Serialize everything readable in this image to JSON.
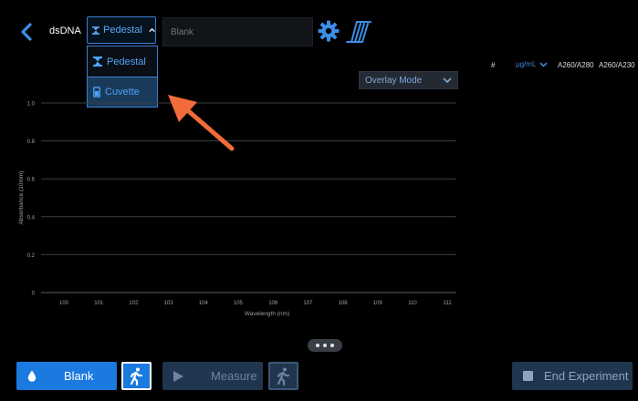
{
  "header": {
    "app_name": "dsDNA",
    "mode_selected": "Pedestal",
    "mode_options": [
      "Pedestal",
      "Cuvette"
    ],
    "sample_placeholder": "Blank"
  },
  "overlay": {
    "label": "Overlay Mode"
  },
  "table": {
    "col_num": "#",
    "unit": "µg/mL",
    "col_a260_280": "A260/A280",
    "col_a260_230": "A260/A230"
  },
  "chart_data": {
    "type": "line",
    "xlabel": "Wavelength (nm)",
    "ylabel": "Absorbance (10mm)",
    "x_ticks": [
      "100",
      "101",
      "102",
      "103",
      "104",
      "105",
      "106",
      "107",
      "108",
      "109",
      "110",
      "111"
    ],
    "y_ticks": [
      "0",
      "0.2",
      "0.4",
      "0.6",
      "0.8",
      "1.0"
    ],
    "xlim": [
      100,
      111
    ],
    "ylim": [
      0,
      1.0
    ],
    "series": []
  },
  "buttons": {
    "blank": "Blank",
    "measure": "Measure",
    "end_experiment": "End Experiment"
  },
  "colors": {
    "accent": "#1a7ae0",
    "dropdown_text": "#4ea3f7",
    "annotation_arrow": "#f26b3a"
  },
  "pager": {
    "dots": 3
  }
}
